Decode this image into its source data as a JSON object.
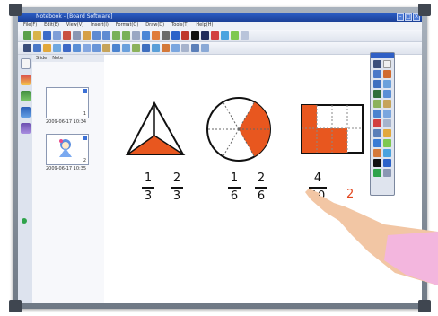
{
  "window": {
    "title": "Notebook - [Board Software]",
    "top_label": "[Notebook]"
  },
  "menu": [
    "File(F)",
    "Edit(E)",
    "View(V)",
    "Insert(I)",
    "Format(O)",
    "Draw(D)",
    "Tools(T)",
    "Help(H)"
  ],
  "sorter_tabs": [
    "Slide",
    "Note"
  ],
  "slides": [
    {
      "number": "1",
      "caption": "2009-06-17 10:34"
    },
    {
      "number": "2",
      "caption": "2009-06-17 10:35"
    }
  ],
  "fractions": [
    {
      "numerator": "1",
      "denominator": "3"
    },
    {
      "numerator": "2",
      "denominator": "3"
    },
    {
      "numerator": "1",
      "denominator": "6"
    },
    {
      "numerator": "2",
      "denominator": "6"
    },
    {
      "numerator": "4",
      "denominator": "10"
    }
  ],
  "partial_red_text": "2",
  "colors": {
    "accent": "#e8571f",
    "title_bar": "#2353b7",
    "frame": "#8c96a2"
  },
  "icons": [
    "pen-icon",
    "eraser-icon",
    "select-icon",
    "text-icon",
    "shape-icon",
    "hand-pointing"
  ]
}
